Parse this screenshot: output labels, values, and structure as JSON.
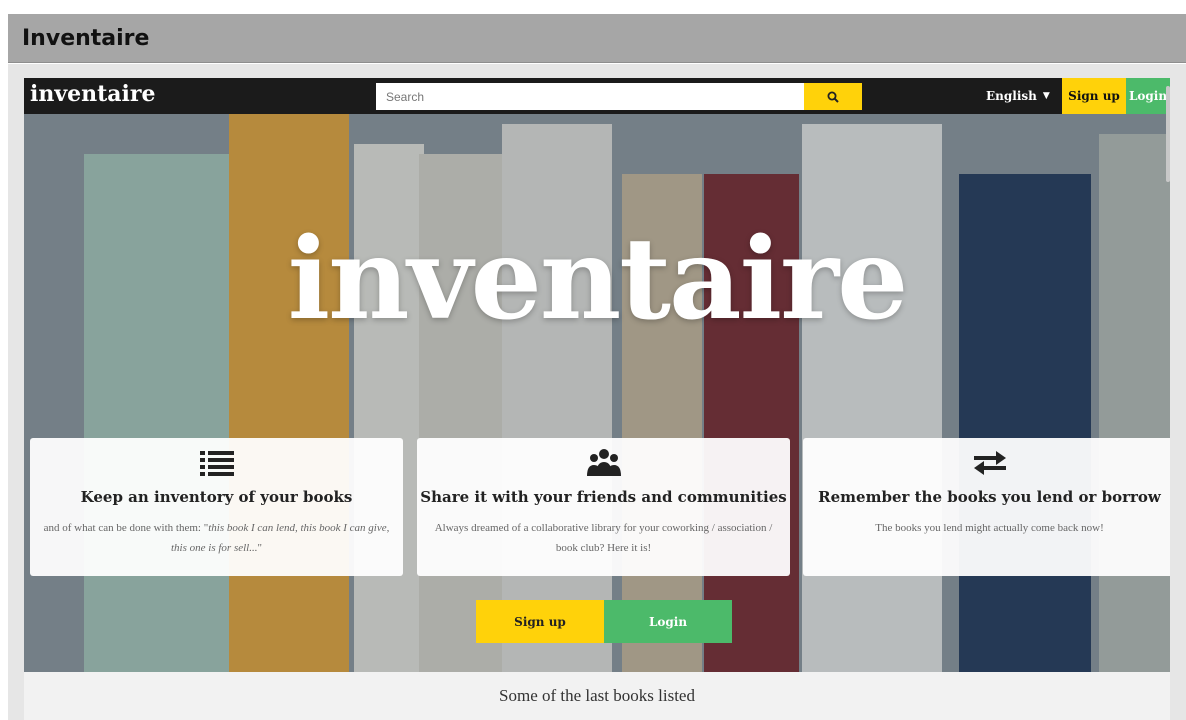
{
  "window": {
    "title": "Inventaire"
  },
  "nav": {
    "logo": "inventaire",
    "search_placeholder": "Search",
    "search_icon": "search-icon",
    "language": "English",
    "signup": "Sign up",
    "login": "Login"
  },
  "hero": {
    "title": "inventaire",
    "features": [
      {
        "icon": "list-icon",
        "title": "Keep an inventory of your books",
        "desc_prefix": "and of what can be done with them: \"",
        "desc_italic": "this book I can lend, this book I can give, this one is for sell...",
        "desc_suffix": "\""
      },
      {
        "icon": "users-icon",
        "title": "Share it with your friends and communities",
        "desc": "Always dreamed of a collaborative library for your coworking / association / book club? Here it is!"
      },
      {
        "icon": "exchange-icon",
        "title": "Remember the books you lend or borrow",
        "desc": "The books you lend might actually come back now!"
      }
    ],
    "cta_signup": "Sign up",
    "cta_login": "Login"
  },
  "last_books": {
    "title": "Some of the last books listed"
  },
  "colors": {
    "brand_dark": "#1b1b1b",
    "signup_yellow": "#ffd20a",
    "login_green": "#4cba6a"
  }
}
